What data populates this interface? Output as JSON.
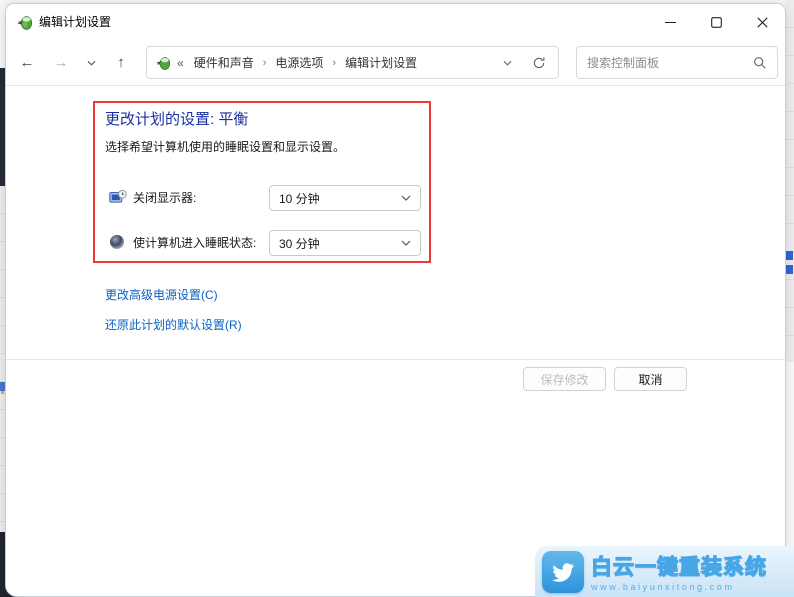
{
  "window": {
    "title": "编辑计划设置",
    "icons": {
      "app": "power-plug",
      "minimize": "—",
      "maximize": "□",
      "close": "✕"
    }
  },
  "navbar": {
    "icons": {
      "back": "←",
      "forward": "→",
      "history_chevron": "⌄",
      "up": "↑",
      "refresh": "⟳"
    },
    "breadcrumb": {
      "collapse": "«",
      "separator": "›",
      "items": [
        "硬件和声音",
        "电源选项",
        "编辑计划设置"
      ]
    },
    "search": {
      "placeholder": "搜索控制面板"
    }
  },
  "main": {
    "heading": "更改计划的设置: 平衡",
    "subtitle": "选择希望计算机使用的睡眠设置和显示设置。",
    "settings": [
      {
        "icon": "display-timeout-icon",
        "label": "关闭显示器:",
        "value": "10 分钟"
      },
      {
        "icon": "sleep-icon",
        "label": "使计算机进入睡眠状态:",
        "value": "30 分钟"
      }
    ],
    "links": [
      "更改高级电源设置(C)",
      "还原此计划的默认设置(R)"
    ],
    "buttons": {
      "save": "保存修改",
      "cancel": "取消"
    },
    "save_disabled": true
  },
  "watermark": {
    "title": "白云一键重装系统",
    "url": "www.baiyunxitong.com"
  },
  "colors": {
    "annotation_red": "#ee3a36",
    "heading_blue": "#1a2fa2",
    "link_blue": "#0b62c4",
    "watermark_blue": "#47a6e6",
    "disabled_text": "#bcbcbc"
  }
}
